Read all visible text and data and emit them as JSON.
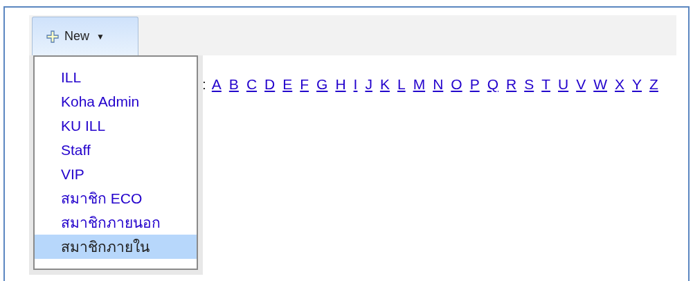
{
  "toolbar": {
    "new_button": {
      "label": "New",
      "caret": "▼",
      "expanded": true
    }
  },
  "menu": {
    "items": [
      {
        "label": "ILL",
        "selected": false
      },
      {
        "label": "Koha Admin",
        "selected": false
      },
      {
        "label": "KU ILL",
        "selected": false
      },
      {
        "label": "Staff",
        "selected": false
      },
      {
        "label": "VIP",
        "selected": false
      },
      {
        "label": "สมาชิก ECO",
        "selected": false
      },
      {
        "label": "สมาชิกภายนอก",
        "selected": false
      },
      {
        "label": "สมาชิกภายใน",
        "selected": true
      }
    ]
  },
  "browse": {
    "label_end": ":",
    "letters": [
      "A",
      "B",
      "C",
      "D",
      "E",
      "F",
      "G",
      "H",
      "I",
      "J",
      "K",
      "L",
      "M",
      "N",
      "O",
      "P",
      "Q",
      "R",
      "S",
      "T",
      "U",
      "V",
      "W",
      "X",
      "Y",
      "Z"
    ]
  }
}
